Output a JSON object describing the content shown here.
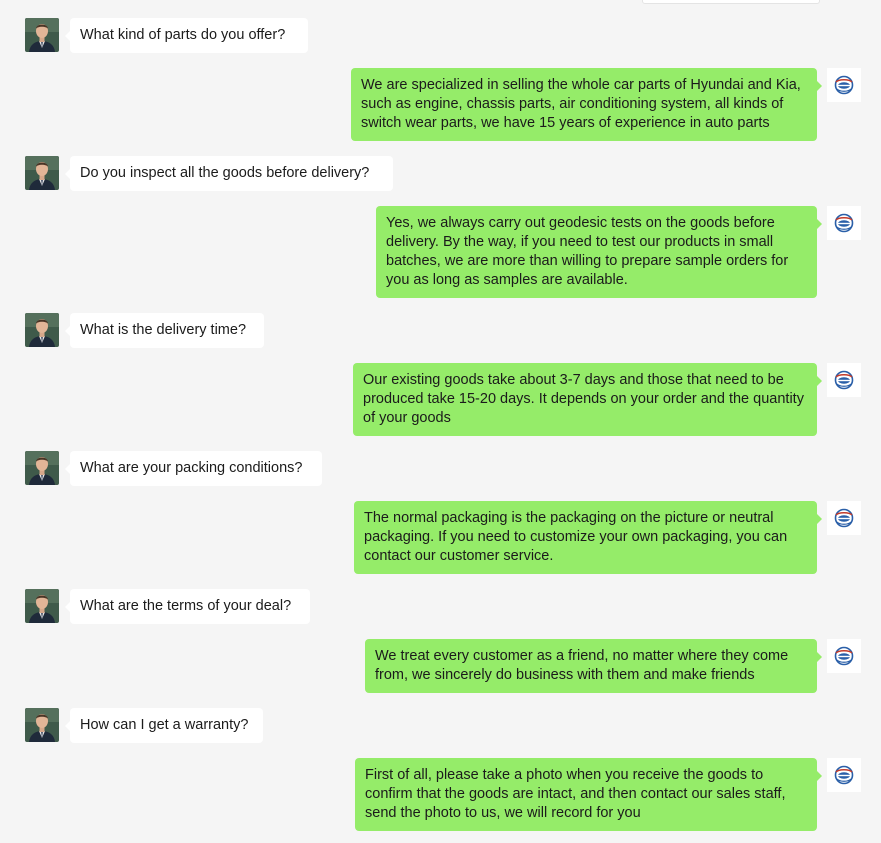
{
  "colors": {
    "background": "#f5f5f5",
    "user_bubble": "#ffffff",
    "bot_bubble": "#95ec69",
    "text": "#1b1b1b"
  },
  "icons": {
    "user_avatar": "user-avatar-photo",
    "bot_avatar": "company-logo-icon"
  },
  "messages": [
    {
      "sender": "user",
      "text": "What kind of parts do you offer?"
    },
    {
      "sender": "bot",
      "text": "We are specialized in selling the whole car parts of Hyundai and Kia, such as engine, chassis parts, air conditioning system, all kinds of switch wear parts, we have 15 years of experience in auto parts"
    },
    {
      "sender": "user",
      "text": "Do you inspect all the goods before delivery?"
    },
    {
      "sender": "bot",
      "text": "Yes, we always carry out geodesic tests on the goods before delivery. By the way, if you need to test our products in small batches, we are more than willing to prepare sample orders for you as long as samples are available."
    },
    {
      "sender": "user",
      "text": "What is the delivery time?"
    },
    {
      "sender": "bot",
      "text": "Our existing goods take about 3-7 days and those that need to be produced take 15-20 days. It depends on your order and the quantity of your goods"
    },
    {
      "sender": "user",
      "text": "What are your packing conditions?"
    },
    {
      "sender": "bot",
      "text": "The normal packaging is the packaging on the picture or neutral packaging. If you need to customize your own packaging, you can contact our customer service."
    },
    {
      "sender": "user",
      "text": "What are the terms of your deal?"
    },
    {
      "sender": "bot",
      "text": "We treat every customer as a friend, no matter where they come from, we sincerely do business with them and make friends"
    },
    {
      "sender": "user",
      "text": "How can I get a warranty?"
    },
    {
      "sender": "bot",
      "text": "First of all, please take a photo when you receive the goods to confirm that the goods are intact, and then contact our sales staff, send the photo to us, we will record for you"
    }
  ]
}
